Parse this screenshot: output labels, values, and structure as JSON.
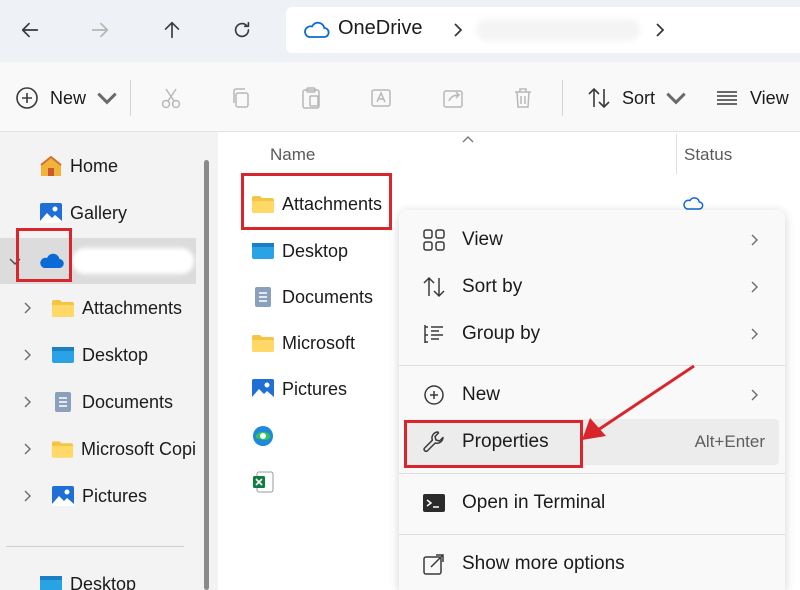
{
  "address": {
    "location": "OneDrive"
  },
  "toolbar": {
    "new_label": "New",
    "sort_label": "Sort",
    "view_label": "View"
  },
  "sidebar": {
    "items": [
      {
        "label": "Home",
        "icon": "home-icon"
      },
      {
        "label": "Gallery",
        "icon": "gallery-icon"
      },
      {
        "label": "",
        "icon": "onedrive-cloud-icon"
      },
      {
        "label": "Attachments",
        "icon": "folder-icon"
      },
      {
        "label": "Desktop",
        "icon": "desktop-folder-icon"
      },
      {
        "label": "Documents",
        "icon": "documents-icon"
      },
      {
        "label": "Microsoft Copi",
        "icon": "folder-icon"
      },
      {
        "label": "Pictures",
        "icon": "pictures-icon"
      },
      {
        "label": "Desktop",
        "icon": "desktop-folder-icon"
      }
    ]
  },
  "content": {
    "columns": {
      "name": "Name",
      "status": "Status"
    },
    "files": [
      {
        "name": "Attachments",
        "icon": "folder-icon"
      },
      {
        "name": "Desktop",
        "icon": "desktop-folder-icon"
      },
      {
        "name": "Documents",
        "icon": "documents-icon"
      },
      {
        "name": "Microsoft",
        "icon": "folder-icon"
      },
      {
        "name": "Pictures",
        "icon": "pictures-icon"
      },
      {
        "name": "",
        "icon": "edge-icon"
      },
      {
        "name": "",
        "icon": "excel-icon"
      }
    ]
  },
  "context_menu": {
    "items": [
      {
        "label": "View",
        "icon": "view-grid-icon",
        "submenu": true
      },
      {
        "label": "Sort by",
        "icon": "sort-icon",
        "submenu": true
      },
      {
        "label": "Group by",
        "icon": "group-by-icon",
        "submenu": true
      },
      {
        "label": "New",
        "icon": "plus-circle-icon",
        "submenu": true
      },
      {
        "label": "Properties",
        "icon": "wrench-icon",
        "shortcut": "Alt+Enter"
      },
      {
        "label": "Open in Terminal",
        "icon": "terminal-icon"
      },
      {
        "label": "Show more options",
        "icon": "share-icon"
      }
    ]
  },
  "colors": {
    "annotation_red": "#d9262c",
    "onedrive_blue": "#0a6ad6",
    "folder_yellow": "#f4c542"
  }
}
